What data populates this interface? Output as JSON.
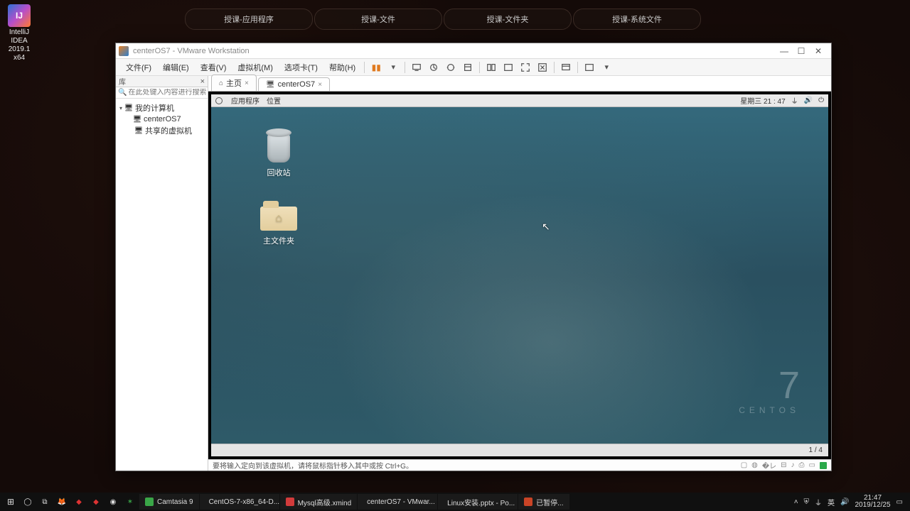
{
  "host_tabs": [
    "授课-应用程序",
    "授课-文件",
    "授课-文件夹",
    "授课-系统文件"
  ],
  "intellij": {
    "label1": "IntelliJ IDEA",
    "label2": "2019.1 x64",
    "badge": "IJ"
  },
  "vm": {
    "title": "centerOS7 - VMware Workstation",
    "menus": [
      "文件(F)",
      "编辑(E)",
      "查看(V)",
      "虚拟机(M)",
      "选项卡(T)",
      "帮助(H)"
    ],
    "library_label": "库",
    "search_placeholder": "在此处键入内容进行搜索",
    "tree": {
      "root": "我的计算机",
      "vm": "centerOS7",
      "shared": "共享的虚拟机"
    },
    "tabs": {
      "home": "主页",
      "vm": "centerOS7"
    },
    "status_hint": "要将输入定向到该虚拟机，请将鼠标指针移入其中或按 Ctrl+G。"
  },
  "guest": {
    "top_left": [
      "应用程序",
      "位置"
    ],
    "clock": "星期三 21 : 47",
    "trash": "回收站",
    "home": "主文件夹",
    "brand_num": "7",
    "brand": "CENTOS",
    "pager": "1 / 4"
  },
  "taskbar": {
    "items": [
      {
        "label": "Camtasia 9",
        "color": "#3aa648"
      },
      {
        "label": "CentOS-7-x86_64-D...",
        "color": "#e06a1e"
      },
      {
        "label": "Mysql高级.xmind",
        "color": "#d23b3b"
      },
      {
        "label": "centerOS7 - VMwar...",
        "color": "#2f7fcc"
      },
      {
        "label": "Linux安装.pptx - Po...",
        "color": "#c94426"
      },
      {
        "label": "已暂停...",
        "color": "#c94426"
      }
    ],
    "tray": {
      "ime": "英",
      "clock_top": "21:47",
      "clock_bot": "2019/12/25"
    }
  }
}
